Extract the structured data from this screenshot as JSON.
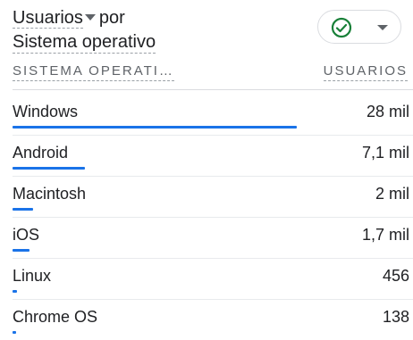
{
  "header": {
    "title_dimension": "Usuarios",
    "title_connector": "por",
    "title_line2": "Sistema operativo",
    "status": {
      "icon": "check-circle-icon",
      "color": "#188038",
      "dropdown_icon": "caret-down-icon"
    }
  },
  "columns": {
    "dimension": "SISTEMA OPERATI…",
    "metric": "USUARIOS"
  },
  "accent_color": "#1a73e8",
  "rows": [
    {
      "name": "Windows",
      "value": "28 mil",
      "share": 1.0
    },
    {
      "name": "Android",
      "value": "7,1 mil",
      "share": 0.254
    },
    {
      "name": "Macintosh",
      "value": "2 mil",
      "share": 0.071
    },
    {
      "name": "iOS",
      "value": "1,7 mil",
      "share": 0.061
    },
    {
      "name": "Linux",
      "value": "456",
      "share": 0.016
    },
    {
      "name": "Chrome OS",
      "value": "138",
      "share": 0.005
    }
  ]
}
